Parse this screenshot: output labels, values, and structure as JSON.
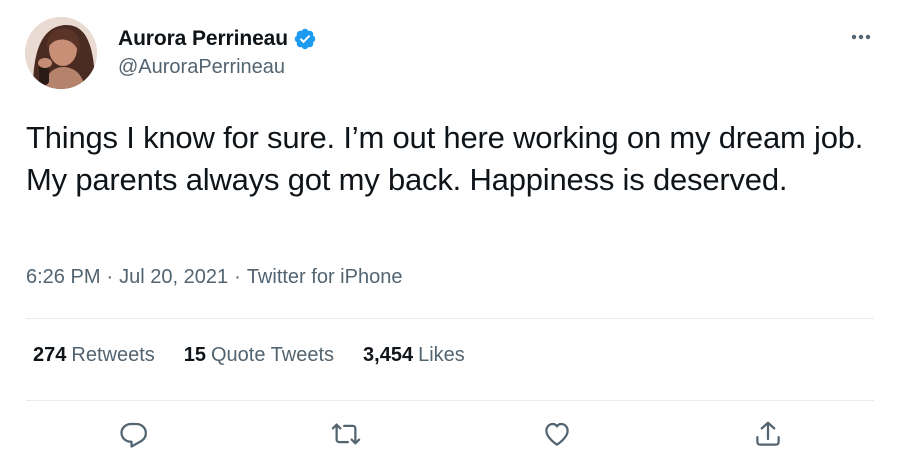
{
  "author": {
    "display_name": "Aurora Perrineau",
    "handle": "@AuroraPerrineau",
    "verified": true
  },
  "tweet": {
    "text": "Things I know for sure. I’m out here working on my dream job. My parents always got my back. Happiness is deserved.",
    "time": "6:26 PM",
    "date": "Jul 20, 2021",
    "source": "Twitter for iPhone",
    "separator": "·"
  },
  "stats": {
    "retweets_count": "274",
    "retweets_label": "Retweets",
    "quotes_count": "15",
    "quotes_label": "Quote Tweets",
    "likes_count": "3,454",
    "likes_label": "Likes"
  },
  "icons": {
    "more": "more-horizontal-icon",
    "verified": "verified-badge-icon",
    "reply": "reply-icon",
    "retweet": "retweet-icon",
    "like": "heart-icon",
    "share": "share-icon"
  },
  "colors": {
    "verified_blue": "#1d9bf0",
    "secondary_text": "#536471",
    "primary_text": "#0f1419",
    "divider": "#e6ecf0"
  }
}
